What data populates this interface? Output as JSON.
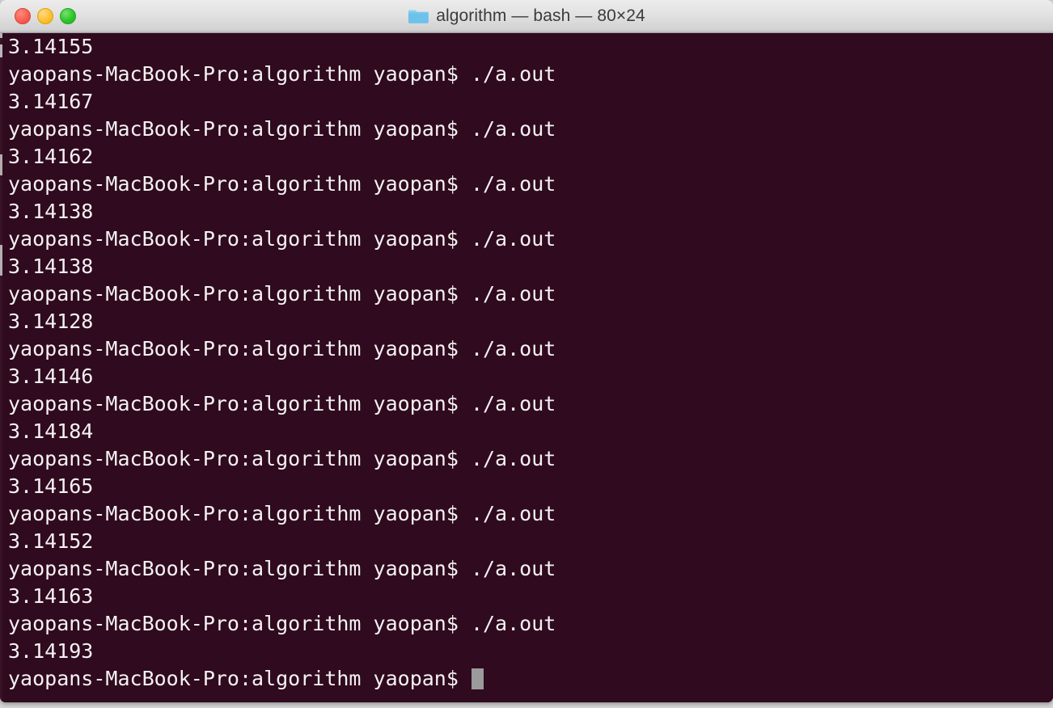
{
  "window": {
    "title": "algorithm — bash — 80×24",
    "folder_icon": "folder-icon",
    "traffic_lights": [
      {
        "name": "close",
        "label": "Close",
        "color": "#fa5e52"
      },
      {
        "name": "minimize",
        "label": "Minimize",
        "color": "#ffc02e"
      },
      {
        "name": "zoom",
        "label": "Zoom",
        "color": "#2cc62c"
      }
    ]
  },
  "terminal": {
    "background_color": "#300a1e",
    "text_color": "#f4f2f3",
    "cursor_color": "#9b9b9b",
    "columns": 80,
    "rows": 24,
    "prompt": "yaopans-MacBook-Pro:algorithm yaopan$",
    "command": "./a.out",
    "lines": [
      "3.14155",
      "yaopans-MacBook-Pro:algorithm yaopan$ ./a.out",
      "3.14167",
      "yaopans-MacBook-Pro:algorithm yaopan$ ./a.out",
      "3.14162",
      "yaopans-MacBook-Pro:algorithm yaopan$ ./a.out",
      "3.14138",
      "yaopans-MacBook-Pro:algorithm yaopan$ ./a.out",
      "3.14138",
      "yaopans-MacBook-Pro:algorithm yaopan$ ./a.out",
      "3.14128",
      "yaopans-MacBook-Pro:algorithm yaopan$ ./a.out",
      "3.14146",
      "yaopans-MacBook-Pro:algorithm yaopan$ ./a.out",
      "3.14184",
      "yaopans-MacBook-Pro:algorithm yaopan$ ./a.out",
      "3.14165",
      "yaopans-MacBook-Pro:algorithm yaopan$ ./a.out",
      "3.14152",
      "yaopans-MacBook-Pro:algorithm yaopan$ ./a.out",
      "3.14163",
      "yaopans-MacBook-Pro:algorithm yaopan$ ./a.out",
      "3.14193"
    ],
    "final_prompt_line": "yaopans-MacBook-Pro:algorithm yaopan$ "
  }
}
